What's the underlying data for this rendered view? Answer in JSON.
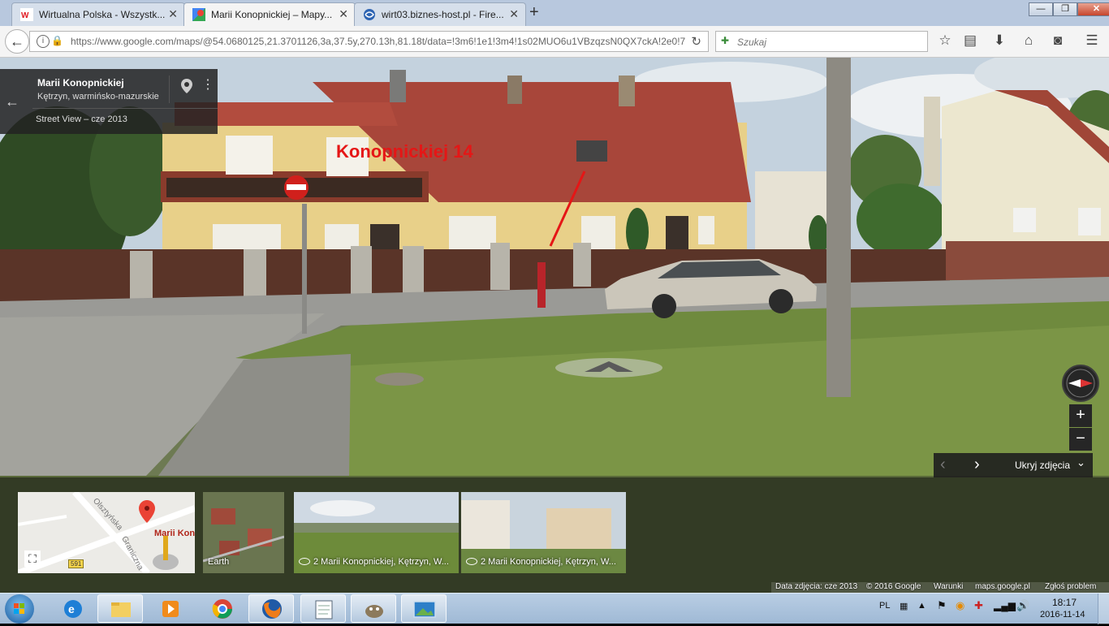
{
  "browser": {
    "tabs": [
      {
        "title": "Wirtualna Polska - Wszystk...",
        "active": false
      },
      {
        "title": "Marii Konopnickiej – Mapy...",
        "active": true
      },
      {
        "title": "wirt03.biznes-host.pl - Fire...",
        "active": false
      }
    ],
    "url": "https://www.google.com/maps/@54.0680125,21.3701126,3a,37.5y,270.13h,81.18t/data=!3m6!1e1!3m4!1s02MUO6u1VBzqzsN0QX7ckA!2e0!7",
    "search_placeholder": "Szukaj",
    "new_tab": "+",
    "window_buttons": {
      "minimize": "—",
      "maximize": "❐",
      "close": "✕"
    }
  },
  "streetview": {
    "card": {
      "title": "Marii Konopnickiej",
      "subtitle": "Kętrzyn, warmińsko-mazurskie",
      "meta": "Street View – cze 2013"
    },
    "annotation": "Konopnickiej 14",
    "controls": {
      "zoom_in": "+",
      "zoom_out": "−",
      "hide_photos": "Ukryj zdjęcia",
      "prev": "‹",
      "next": "›"
    },
    "sign_number": "14"
  },
  "filmstrip": {
    "map": {
      "street1": "Olsztyńska",
      "street2": "Graniczna",
      "place": "Marii Kon",
      "road": "591"
    },
    "thumbs": [
      {
        "label": "Earth"
      },
      {
        "label": "2 Marii Konopnickiej, Kętrzyn, W..."
      },
      {
        "label": "2 Marii Konopnickiej, Kętrzyn, W..."
      }
    ]
  },
  "footer": {
    "date": "Data zdjęcia: cze 2013",
    "copyright": "© 2016 Google",
    "terms": "Warunki",
    "domain": "maps.google.pl",
    "report": "Zgłoś problem"
  },
  "taskbar": {
    "lang": "PL",
    "time": "18:17",
    "date": "2016-11-14"
  },
  "colors": {
    "annotation": "#e51616",
    "roof": "#a8463a",
    "wall": "#e8d089",
    "grass": "#6f8a3e",
    "pavement": "#9a9a96"
  }
}
